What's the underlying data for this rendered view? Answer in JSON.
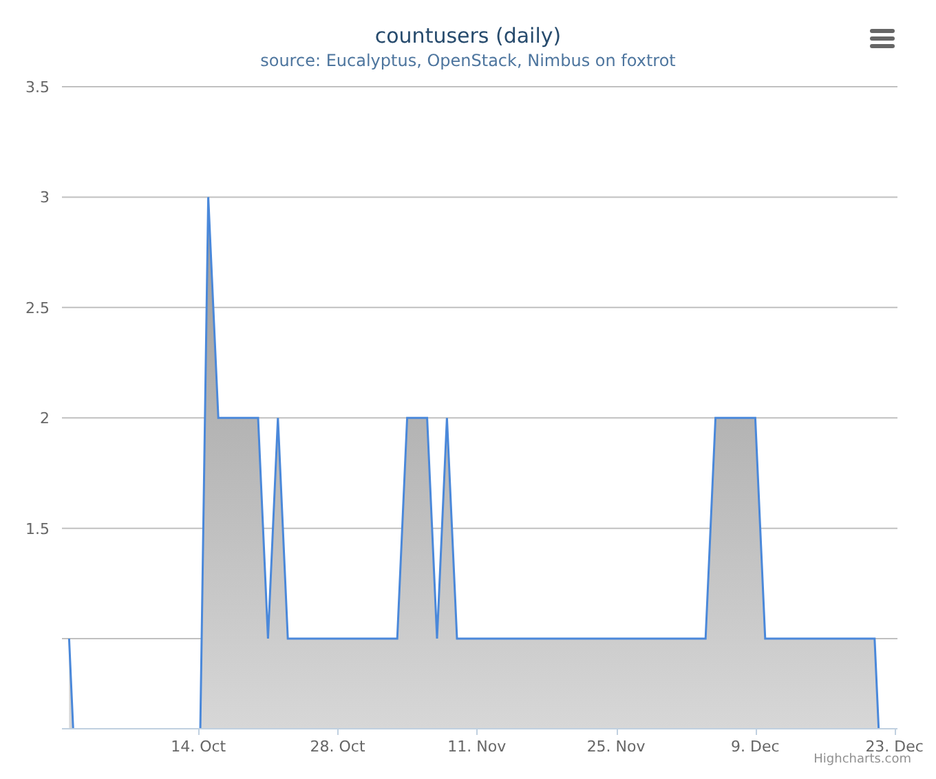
{
  "chart": {
    "subtitle": "source: Eucalyptus, OpenStack, Nimbus on foxtrot",
    "credits": "Highcharts.com",
    "chart_data": {
      "type": "area",
      "title": "countusers (daily)",
      "categories": [
        null,
        null,
        null,
        null,
        null,
        null,
        null,
        null,
        null,
        null,
        null,
        null,
        null,
        "14. Oct",
        null,
        null,
        null,
        null,
        null,
        null,
        null,
        null,
        null,
        null,
        null,
        null,
        null,
        "28. Oct",
        null,
        null,
        null,
        null,
        null,
        null,
        null,
        null,
        null,
        null,
        null,
        null,
        null,
        "11. Nov",
        null,
        null,
        null,
        null,
        null,
        null,
        null,
        null,
        null,
        null,
        null,
        null,
        null,
        "25. Nov",
        null,
        null,
        null,
        null,
        null,
        null,
        null,
        null,
        null,
        null,
        null,
        null,
        null,
        "9. Dec",
        null,
        null,
        null,
        null,
        null,
        null,
        null,
        null,
        null,
        null,
        null,
        null,
        null,
        "23. Dec"
      ],
      "series": [
        {
          "color": "#4a88da",
          "values": [
            1,
            null,
            null,
            null,
            null,
            null,
            null,
            null,
            null,
            null,
            null,
            null,
            null,
            null,
            3,
            2,
            2,
            2,
            2,
            2,
            1,
            2,
            1,
            1,
            1,
            1,
            1,
            1,
            1,
            1,
            1,
            1,
            1,
            1,
            2,
            2,
            2,
            1,
            2,
            1,
            1,
            1,
            1,
            1,
            1,
            1,
            1,
            1,
            1,
            1,
            1,
            1,
            1,
            1,
            1,
            1,
            1,
            1,
            1,
            1,
            1,
            1,
            1,
            1,
            1,
            2,
            2,
            2,
            2,
            2,
            1,
            1,
            1,
            1,
            1,
            1,
            1,
            1,
            1,
            1,
            1,
            1,
            null,
            null
          ]
        }
      ],
      "grid": true,
      "ylim": [
        0.595,
        3.5
      ],
      "yticks": [
        {
          "value": 1.5,
          "label": "1.5"
        },
        {
          "value": 2,
          "label": "2"
        },
        {
          "value": 2.5,
          "label": "2.5"
        },
        {
          "value": 3,
          "label": "3"
        },
        {
          "value": 3.5,
          "label": "3.5"
        }
      ]
    }
  }
}
